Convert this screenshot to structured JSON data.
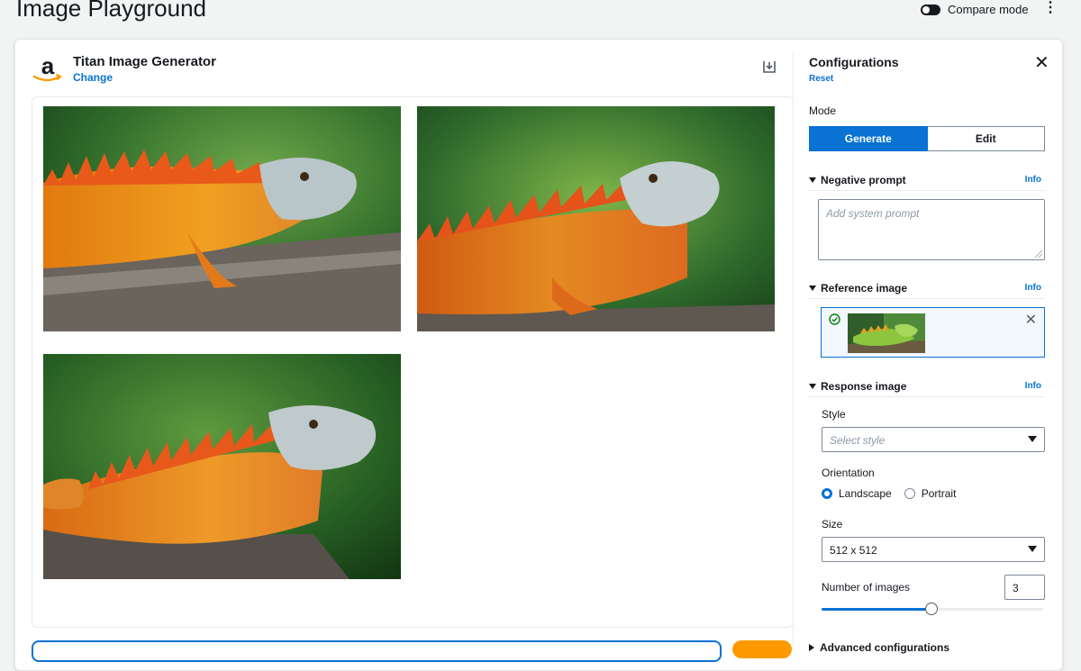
{
  "page": {
    "title": "Image Playground"
  },
  "header": {
    "compare_label": "Compare mode",
    "compare_on": true,
    "menu_icon": "kebab-icon"
  },
  "model": {
    "name": "Titan Image Generator",
    "change_label": "Change",
    "logo_icon": "amazon-logo"
  },
  "gallery": {
    "download_icon": "download-icon",
    "images": [
      {
        "name": "generated-image-1"
      },
      {
        "name": "generated-image-2"
      },
      {
        "name": "generated-image-3"
      }
    ]
  },
  "config": {
    "title": "Configurations",
    "reset_label": "Reset",
    "mode_label": "Mode",
    "mode_options": [
      "Generate",
      "Edit"
    ],
    "mode_selected": "Generate",
    "info_label": "Info",
    "negative_prompt": {
      "label": "Negative prompt",
      "placeholder": "Add system prompt"
    },
    "reference_image": {
      "label": "Reference image"
    },
    "response_image": {
      "label": "Response image",
      "style_label": "Style",
      "style_placeholder": "Select style",
      "orientation_label": "Orientation",
      "orientation_options": [
        "Landscape",
        "Portrait"
      ],
      "orientation_selected": "Landscape",
      "size_label": "Size",
      "size_value": "512 x 512",
      "count_label": "Number of images",
      "count_value": "3",
      "count_slider_fraction": 0.49
    },
    "advanced_label": "Advanced configurations"
  },
  "colors": {
    "accent": "#0972d3",
    "run_button": "#ff9900"
  }
}
